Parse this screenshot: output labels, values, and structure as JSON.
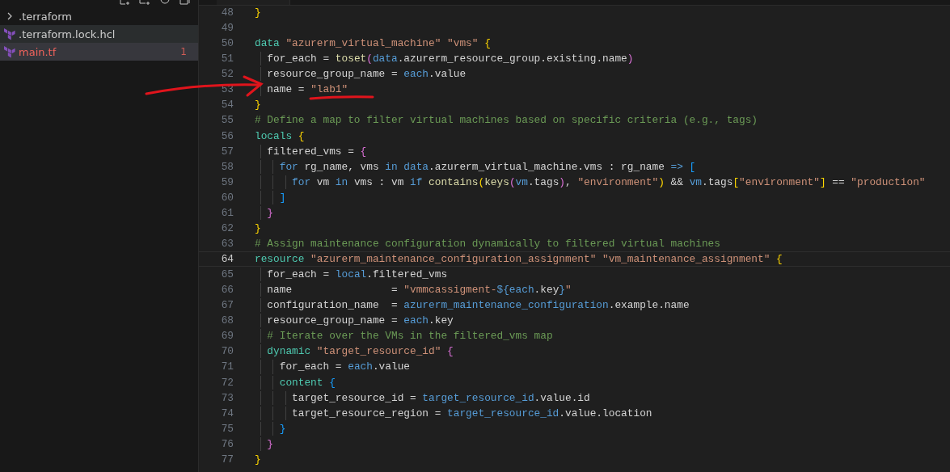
{
  "explorer": {
    "items": [
      {
        "kind": "folder",
        "name": ".terraform",
        "expanded": false,
        "selected": false,
        "hovered": false,
        "error": false
      },
      {
        "kind": "file",
        "name": ".terraform.lock.hcl",
        "selected": false,
        "hovered": true,
        "error": false
      },
      {
        "kind": "file",
        "name": "main.tf",
        "selected": true,
        "hovered": false,
        "error": true,
        "problems": "1"
      }
    ]
  },
  "editor": {
    "lines": [
      {
        "number": "48",
        "current": false,
        "tokens": [
          {
            "kind": "bracket1",
            "text": "}"
          }
        ]
      },
      {
        "number": "49",
        "current": false
      },
      {
        "number": "50",
        "current": false,
        "tokens": [
          {
            "kind": "keyword",
            "text": "data"
          },
          {
            "kind": "string",
            "text": " \"azurerm_virtual_machine\" \"vms\""
          },
          {
            "kind": "bracket1",
            "text": " {"
          }
        ]
      },
      {
        "number": "51",
        "current": false,
        "tokens": [
          {
            "kind": "plain",
            "text": "  for_each = "
          },
          {
            "kind": "function",
            "text": "toset"
          },
          {
            "kind": "bracket2",
            "text": "("
          },
          {
            "kind": "variable",
            "text": "data"
          },
          {
            "kind": "plain",
            "text": ".azurerm_resource_group.existing.name"
          },
          {
            "kind": "bracket2",
            "text": ")"
          }
        ]
      },
      {
        "number": "52",
        "current": false,
        "tokens": [
          {
            "kind": "plain",
            "text": "  resource_group_name = "
          },
          {
            "kind": "variable",
            "text": "each"
          },
          {
            "kind": "plain",
            "text": ".value"
          }
        ]
      },
      {
        "number": "53",
        "current": false,
        "tokens": [
          {
            "kind": "plain",
            "text": "  name = "
          },
          {
            "kind": "string",
            "text": "\"lab1\""
          }
        ]
      },
      {
        "number": "54",
        "current": false,
        "tokens": [
          {
            "kind": "bracket1",
            "text": "}"
          }
        ]
      },
      {
        "number": "55",
        "current": false,
        "tokens": [
          {
            "kind": "comment",
            "text": "# Define a map to filter virtual machines based on specific criteria (e.g., tags)"
          }
        ]
      },
      {
        "number": "56",
        "current": false,
        "tokens": [
          {
            "kind": "keyword",
            "text": "locals"
          },
          {
            "kind": "bracket1",
            "text": " {"
          }
        ]
      },
      {
        "number": "57",
        "current": false,
        "tokens": [
          {
            "kind": "plain",
            "text": "  filtered_vms = "
          },
          {
            "kind": "bracket2",
            "text": "{"
          }
        ]
      },
      {
        "number": "58",
        "current": false,
        "tokens": [
          {
            "kind": "variable",
            "text": "    for"
          },
          {
            "kind": "plain",
            "text": " rg_name, vms "
          },
          {
            "kind": "variable",
            "text": "in"
          },
          {
            "kind": "variable",
            "text": " data"
          },
          {
            "kind": "plain",
            "text": ".azurerm_virtual_machine.vms : rg_name "
          },
          {
            "kind": "variable",
            "text": "=>"
          },
          {
            "kind": "bracket3",
            "text": " ["
          }
        ]
      },
      {
        "number": "59",
        "current": false,
        "tokens": [
          {
            "kind": "variable",
            "text": "      for"
          },
          {
            "kind": "plain",
            "text": " vm "
          },
          {
            "kind": "variable",
            "text": "in"
          },
          {
            "kind": "plain",
            "text": " vms : vm "
          },
          {
            "kind": "variable",
            "text": "if"
          },
          {
            "kind": "function",
            "text": " contains"
          },
          {
            "kind": "bracket1",
            "text": "("
          },
          {
            "kind": "function",
            "text": "keys"
          },
          {
            "kind": "bracket2",
            "text": "("
          },
          {
            "kind": "variable",
            "text": "vm"
          },
          {
            "kind": "plain",
            "text": ".tags"
          },
          {
            "kind": "bracket2",
            "text": ")"
          },
          {
            "kind": "plain",
            "text": ", "
          },
          {
            "kind": "string",
            "text": "\"environment\""
          },
          {
            "kind": "bracket1",
            "text": ")"
          },
          {
            "kind": "plain",
            "text": " && "
          },
          {
            "kind": "variable",
            "text": "vm"
          },
          {
            "kind": "plain",
            "text": ".tags"
          },
          {
            "kind": "bracket1",
            "text": "["
          },
          {
            "kind": "string",
            "text": "\"environment\""
          },
          {
            "kind": "bracket1",
            "text": "]"
          },
          {
            "kind": "plain",
            "text": " == "
          },
          {
            "kind": "string",
            "text": "\"production\""
          }
        ]
      },
      {
        "number": "60",
        "current": false,
        "tokens": [
          {
            "kind": "bracket3",
            "text": "    ]"
          }
        ]
      },
      {
        "number": "61",
        "current": false,
        "tokens": [
          {
            "kind": "bracket2",
            "text": "  }"
          }
        ]
      },
      {
        "number": "62",
        "current": false,
        "tokens": [
          {
            "kind": "bracket1",
            "text": "}"
          }
        ]
      },
      {
        "number": "63",
        "current": false,
        "tokens": [
          {
            "kind": "comment",
            "text": "# Assign maintenance configuration dynamically to filtered virtual machines"
          }
        ]
      },
      {
        "number": "64",
        "current": true,
        "tokens": [
          {
            "kind": "keyword",
            "text": "resource"
          },
          {
            "kind": "string",
            "text": " \"azurerm_maintenance_configuration_assignment\" \"vm_maintenance_assignment\""
          },
          {
            "kind": "bracket1",
            "text": " {"
          }
        ]
      },
      {
        "number": "65",
        "current": false,
        "tokens": [
          {
            "kind": "plain",
            "text": "  for_each = "
          },
          {
            "kind": "variable",
            "text": "local"
          },
          {
            "kind": "plain",
            "text": ".filtered_vms"
          }
        ]
      },
      {
        "number": "66",
        "current": false,
        "tokens": [
          {
            "kind": "plain",
            "text": "  name                = "
          },
          {
            "kind": "string",
            "text": "\"vmmcassigment-"
          },
          {
            "kind": "variable",
            "text": "${each"
          },
          {
            "kind": "plain",
            "text": ".key"
          },
          {
            "kind": "variable",
            "text": "}"
          },
          {
            "kind": "string",
            "text": "\""
          }
        ]
      },
      {
        "number": "67",
        "current": false,
        "tokens": [
          {
            "kind": "plain",
            "text": "  configuration_name  = "
          },
          {
            "kind": "variable",
            "text": "azurerm_maintenance_configuration"
          },
          {
            "kind": "plain",
            "text": ".example.name"
          }
        ]
      },
      {
        "number": "68",
        "current": false,
        "tokens": [
          {
            "kind": "plain",
            "text": "  resource_group_name = "
          },
          {
            "kind": "variable",
            "text": "each"
          },
          {
            "kind": "plain",
            "text": ".key"
          }
        ]
      },
      {
        "number": "69",
        "current": false,
        "tokens": [
          {
            "kind": "comment",
            "text": "  # Iterate over the VMs in the filtered_vms map"
          }
        ]
      },
      {
        "number": "70",
        "current": false,
        "tokens": [
          {
            "kind": "keyword",
            "text": "  dynamic"
          },
          {
            "kind": "string",
            "text": " \"target_resource_id\""
          },
          {
            "kind": "bracket2",
            "text": " {"
          }
        ]
      },
      {
        "number": "71",
        "current": false,
        "tokens": [
          {
            "kind": "plain",
            "text": "    for_each = "
          },
          {
            "kind": "variable",
            "text": "each"
          },
          {
            "kind": "plain",
            "text": ".value"
          }
        ]
      },
      {
        "number": "72",
        "current": false,
        "tokens": [
          {
            "kind": "keyword",
            "text": "    content"
          },
          {
            "kind": "bracket3",
            "text": " {"
          }
        ]
      },
      {
        "number": "73",
        "current": false,
        "tokens": [
          {
            "kind": "plain",
            "text": "      target_resource_id = "
          },
          {
            "kind": "variable",
            "text": "target_resource_id"
          },
          {
            "kind": "plain",
            "text": ".value.id"
          }
        ]
      },
      {
        "number": "74",
        "current": false,
        "tokens": [
          {
            "kind": "plain",
            "text": "      target_resource_region = "
          },
          {
            "kind": "variable",
            "text": "target_resource_id"
          },
          {
            "kind": "plain",
            "text": ".value.location"
          }
        ]
      },
      {
        "number": "75",
        "current": false,
        "tokens": [
          {
            "kind": "bracket3",
            "text": "    }"
          }
        ]
      },
      {
        "number": "76",
        "current": false,
        "tokens": [
          {
            "kind": "bracket2",
            "text": "  }"
          }
        ]
      },
      {
        "number": "77",
        "current": false,
        "tokens": [
          {
            "kind": "bracket1",
            "text": "}"
          }
        ]
      }
    ]
  }
}
